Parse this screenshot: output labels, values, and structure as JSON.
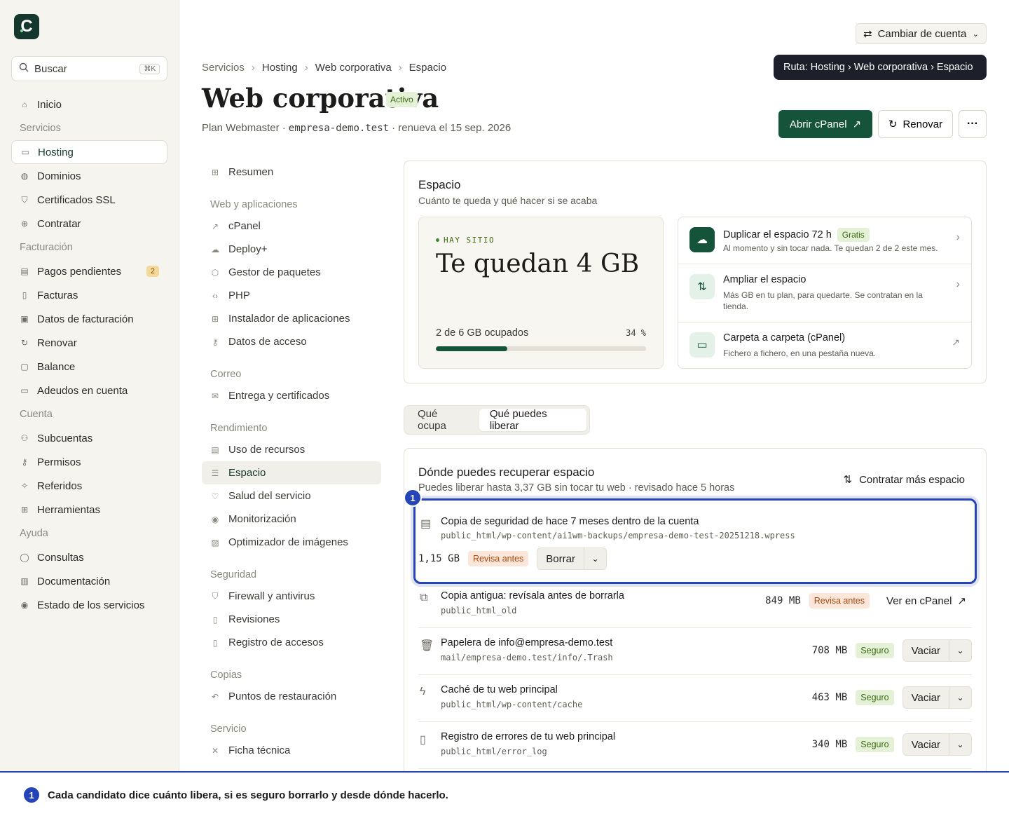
{
  "brand": {
    "logo_letter": "C"
  },
  "search": {
    "placeholder": "Buscar",
    "shortcut": "⌘K"
  },
  "sidebar": {
    "items": [
      {
        "label": "Inicio"
      },
      {
        "section": "Servicios"
      },
      {
        "label": "Hosting"
      },
      {
        "label": "Dominios"
      },
      {
        "label": "Certificados SSL"
      },
      {
        "label": "Contratar"
      },
      {
        "section": "Facturación"
      },
      {
        "label": "Pagos pendientes",
        "badge": "2"
      },
      {
        "label": "Facturas"
      },
      {
        "label": "Datos de facturación"
      },
      {
        "label": "Renovar"
      },
      {
        "label": "Balance"
      },
      {
        "label": "Adeudos en cuenta"
      },
      {
        "section": "Cuenta"
      },
      {
        "label": "Subcuentas"
      },
      {
        "label": "Permisos"
      },
      {
        "label": "Referidos"
      },
      {
        "label": "Herramientas"
      },
      {
        "section": "Ayuda"
      },
      {
        "label": "Consultas"
      },
      {
        "label": "Documentación"
      },
      {
        "label": "Estado de los servicios"
      }
    ]
  },
  "header": {
    "account_switch": "Cambiar de cuenta",
    "tooltip": "Ruta: Hosting › Web corporativa › Espacio",
    "breadcrumb": [
      "Servicios",
      "Hosting",
      "Web corporativa",
      "Espacio"
    ],
    "title": "Web corporativa",
    "status": "Activo",
    "plan": "Plan Webmaster ·",
    "domain": "empresa-demo.test",
    "renew": "· renueva el 15 sep. 2026",
    "btn_cpanel": "Abrir cPanel",
    "btn_renew": "Renovar",
    "btn_more": "···"
  },
  "subnav": {
    "resumen": "Resumen",
    "sec_web": "Web y aplicaciones",
    "cpanel": "cPanel",
    "deploy": "Deploy+",
    "gestor": "Gestor de paquetes",
    "php": "PHP",
    "instalador": "Instalador de aplicaciones",
    "datos_acceso": "Datos de acceso",
    "sec_correo": "Correo",
    "entrega": "Entrega y certificados",
    "sec_rend": "Rendimiento",
    "uso": "Uso de recursos",
    "espacio": "Espacio",
    "salud": "Salud del servicio",
    "monitor": "Monitorización",
    "optim": "Optimizador de imágenes",
    "sec_seg": "Seguridad",
    "firewall": "Firewall y antivirus",
    "revisiones": "Revisiones",
    "registro": "Registro de accesos",
    "sec_copias": "Copias",
    "puntos": "Puntos de restauración",
    "sec_servicio": "Servicio",
    "ficha": "Ficha técnica"
  },
  "space": {
    "title": "Espacio",
    "subtitle": "Cuánto te queda y qué hacer si se acaba",
    "hero_tag": "HAY SITIO",
    "hero_value": "Te quedan 4 GB",
    "used_text": "2 de 6 GB ocupados",
    "used_pct_label": "34 %",
    "used_fraction": 0.34,
    "options": [
      {
        "title": "Duplicar el espacio 72 h",
        "tag": "Gratis",
        "desc": "Al momento y sin tocar nada. Te quedan 2 de 2 este mes."
      },
      {
        "title": "Ampliar el espacio",
        "desc": "Más GB en tu plan, para quedarte. Se contratan en la tienda."
      },
      {
        "title": "Carpeta a carpeta (cPanel)",
        "desc": "Fichero a fichero, en una pestaña nueva."
      }
    ]
  },
  "tabs": [
    "Qué ocupa",
    "Qué puedes liberar"
  ],
  "recover": {
    "title": "Dónde puedes recuperar espacio",
    "subtitle": "Puedes liberar hasta 3,37 GB sin tocar tu web · revisado hace 5 horas",
    "more_space": "Contratar más espacio",
    "highlight": {
      "title": "Copia de seguridad de hace 7 meses dentro de la cuenta",
      "path": "public_html/wp-content/ai1wm-backups/empresa-demo-test-20251218.wpress",
      "size": "1,15 GB",
      "status": "Revisa antes",
      "action": "Borrar"
    },
    "rows": [
      {
        "title": "Copia antigua: revísala antes de borrarla",
        "path": "public_html_old",
        "size": "849 MB",
        "status": "Revisa antes",
        "action": "Ver en cPanel"
      },
      {
        "title": "Papelera de info@empresa-demo.test",
        "path": "mail/empresa-demo.test/info/.Trash",
        "size": "708 MB",
        "status": "Seguro",
        "action": "Vaciar"
      },
      {
        "title": "Caché de tu web principal",
        "path": "public_html/wp-content/cache",
        "size": "463 MB",
        "status": "Seguro",
        "action": "Vaciar"
      },
      {
        "title": "Registro de errores de tu web principal",
        "path": "public_html/error_log",
        "size": "340 MB",
        "status": "Seguro",
        "action": "Vaciar"
      }
    ]
  },
  "annotation": {
    "number": "1",
    "text": "Cada candidato dice cuánto libera, si es seguro borrarlo y desde dónde hacerlo."
  },
  "colors": {
    "brand": "#15533b",
    "accent": "#2544b8",
    "warn": "#a9480f",
    "safe": "#3b6a12"
  }
}
